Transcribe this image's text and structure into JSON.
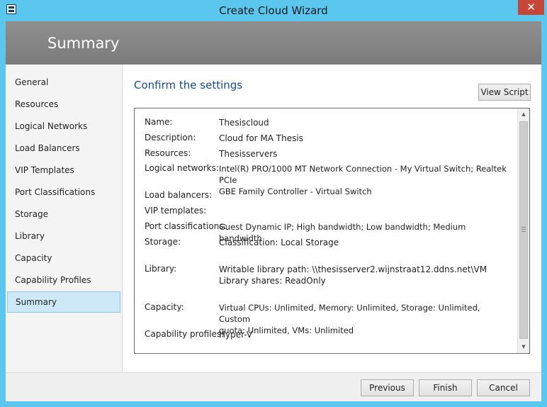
{
  "window": {
    "title": "Create Cloud Wizard",
    "close_glyph": "✕"
  },
  "header": {
    "title": "Summary"
  },
  "nav": {
    "items": [
      {
        "label": "General"
      },
      {
        "label": "Resources"
      },
      {
        "label": "Logical Networks"
      },
      {
        "label": "Load Balancers"
      },
      {
        "label": "VIP Templates"
      },
      {
        "label": "Port Classifications"
      },
      {
        "label": "Storage"
      },
      {
        "label": "Library"
      },
      {
        "label": "Capacity"
      },
      {
        "label": "Capability Profiles"
      },
      {
        "label": "Summary",
        "selected": true
      }
    ]
  },
  "main": {
    "heading": "Confirm the settings",
    "view_script_label": "View Script"
  },
  "summary": {
    "rows": [
      {
        "label": "Name:",
        "lines": [
          "Thesiscloud"
        ]
      },
      {
        "label": "Description:",
        "lines": [
          "Cloud for MA Thesis"
        ]
      },
      {
        "label": "Resources:",
        "lines": [
          "Thesisservers"
        ]
      },
      {
        "label": "Logical networks:",
        "lines": [
          "Intel(R) PRO/1000 MT Network Connection - My Virtual Switch; Realtek PCIe",
          "GBE Family Controller - Virtual Switch"
        ]
      },
      {
        "label": "Load balancers:",
        "lines": [
          ""
        ]
      },
      {
        "label": "VIP templates:",
        "lines": [
          ""
        ]
      },
      {
        "label": "Port classifications:",
        "lines": [
          "Guest Dynamic IP; High bandwidth; Low bandwidth; Medium bandwidth"
        ]
      },
      {
        "label": "Storage:",
        "lines": [
          "Classification: Local Storage"
        ]
      },
      {
        "label": "Library:",
        "lines": [
          "Writable library path: \\\\thesisserver2.wijnstraat12.ddns.net\\VM",
          "Library shares: ReadOnly"
        ]
      },
      {
        "label": "Capacity:",
        "lines": [
          "Virtual CPUs: Unlimited, Memory: Unlimited, Storage: Unlimited, Custom",
          "quota: Unlimited, VMs: Unlimited"
        ]
      },
      {
        "label": "Capability profiles:",
        "lines": [
          "Hyper-V"
        ]
      }
    ]
  },
  "footer": {
    "previous_label": "Previous",
    "finish_label": "Finish",
    "cancel_label": "Cancel"
  },
  "colors": {
    "window_frame": "#5bc6ee",
    "close_button": "#c7463a",
    "header_band": "#858585",
    "heading_text": "#1a4a8a",
    "nav_selected": "#cde8f7"
  }
}
